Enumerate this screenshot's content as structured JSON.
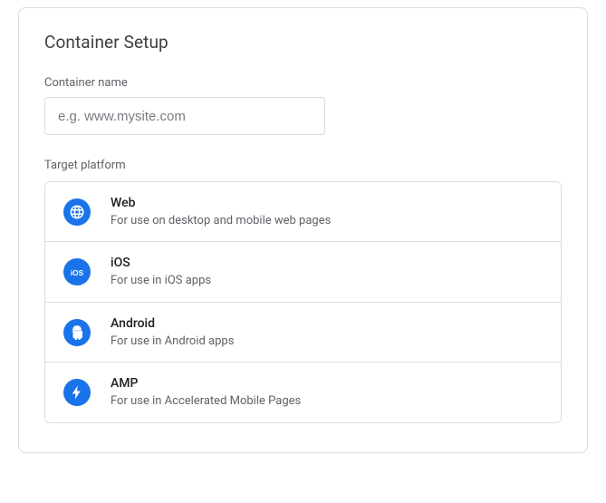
{
  "title": "Container Setup",
  "container_name": {
    "label": "Container name",
    "value": "",
    "placeholder": "e.g. www.mysite.com"
  },
  "platform_section_label": "Target platform",
  "platforms": [
    {
      "name": "Web",
      "desc": "For use on desktop and mobile web pages"
    },
    {
      "name": "iOS",
      "desc": "For use in iOS apps"
    },
    {
      "name": "Android",
      "desc": "For use in Android apps"
    },
    {
      "name": "AMP",
      "desc": "For use in Accelerated Mobile Pages"
    }
  ]
}
